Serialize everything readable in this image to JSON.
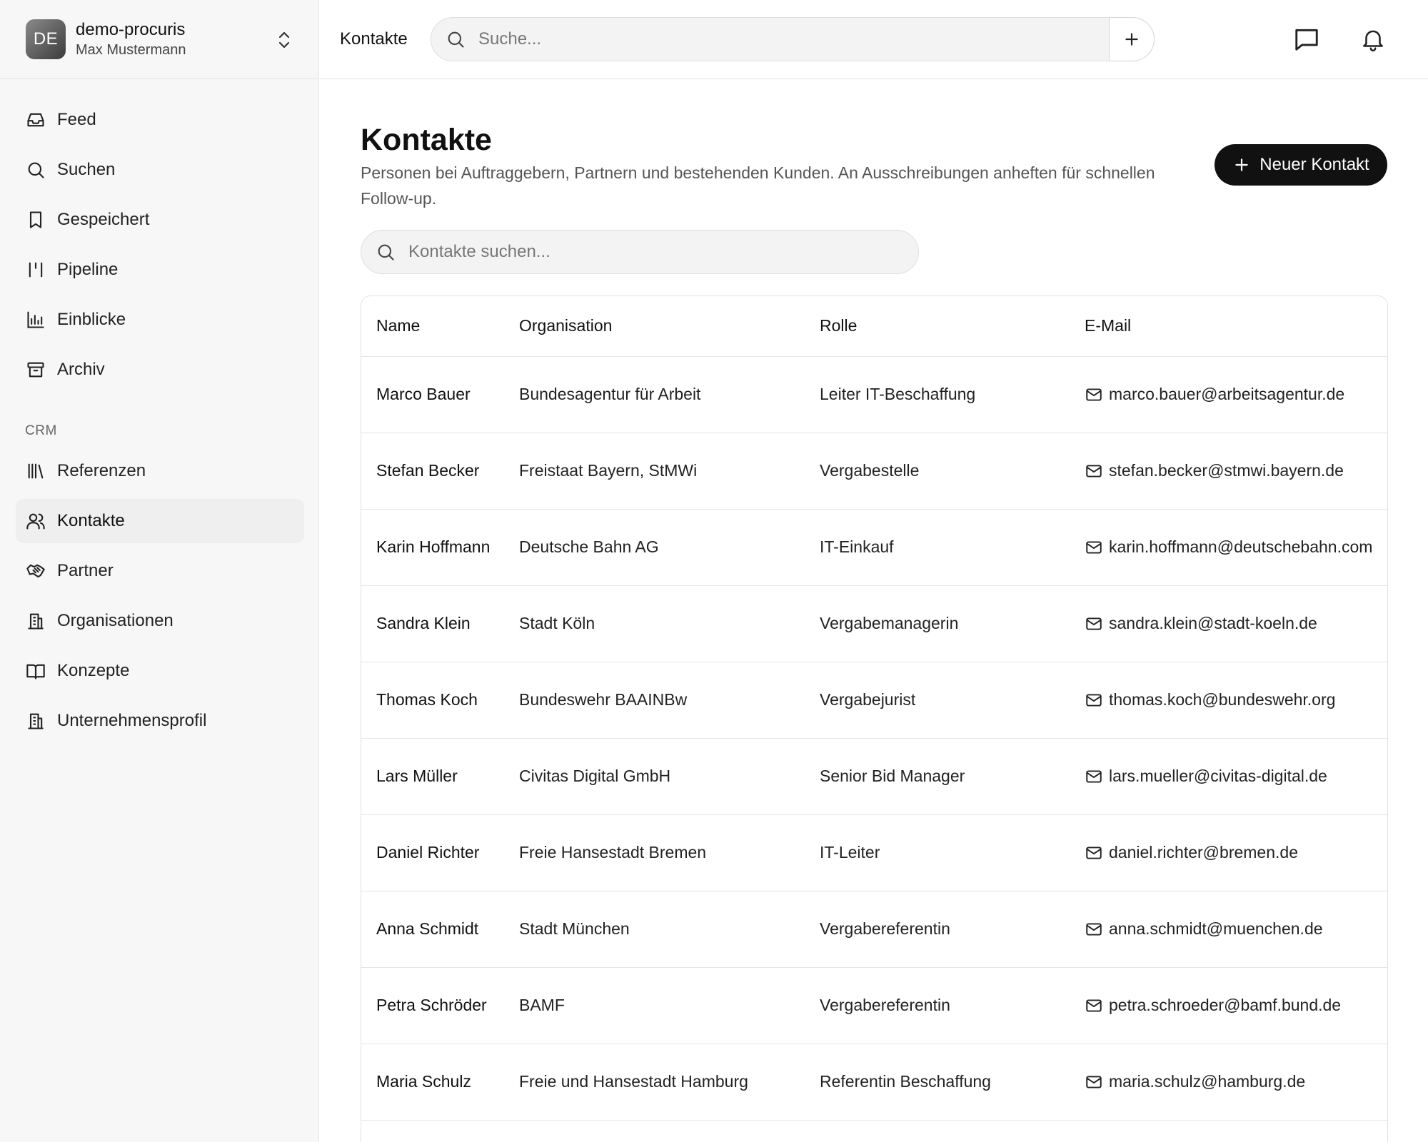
{
  "workspace": {
    "initials": "DE",
    "name": "demo-procuris",
    "user": "Max Mustermann"
  },
  "sidebar": {
    "items": [
      {
        "label": "Feed",
        "icon": "inbox-icon"
      },
      {
        "label": "Suchen",
        "icon": "search-icon"
      },
      {
        "label": "Gespeichert",
        "icon": "bookmark-icon"
      },
      {
        "label": "Pipeline",
        "icon": "pipeline-icon"
      },
      {
        "label": "Einblicke",
        "icon": "bar-chart-icon"
      },
      {
        "label": "Archiv",
        "icon": "archive-icon"
      }
    ],
    "crm_title": "CRM",
    "crm_items": [
      {
        "label": "Referenzen",
        "icon": "library-icon"
      },
      {
        "label": "Kontakte",
        "icon": "users-icon",
        "active": true
      },
      {
        "label": "Partner",
        "icon": "handshake-icon"
      },
      {
        "label": "Organisationen",
        "icon": "building-icon"
      },
      {
        "label": "Konzepte",
        "icon": "book-open-icon"
      },
      {
        "label": "Unternehmensprofil",
        "icon": "building-icon"
      }
    ]
  },
  "topbar": {
    "title": "Kontakte",
    "search_placeholder": "Suche..."
  },
  "page": {
    "title": "Kontakte",
    "description": "Personen bei Auftraggebern, Partnern und bestehenden Kunden. An Ausschreibungen anheften für schnellen Follow-up.",
    "new_button": "Neuer Kontakt",
    "search_placeholder": "Kontakte suchen..."
  },
  "table": {
    "columns": [
      "Name",
      "Organisation",
      "Rolle",
      "E-Mail"
    ],
    "rows": [
      {
        "name": "Marco Bauer",
        "org": "Bundesagentur für Arbeit",
        "role": "Leiter IT-Beschaffung",
        "email": "marco.bauer@arbeitsagentur.de"
      },
      {
        "name": "Stefan Becker",
        "org": "Freistaat Bayern, StMWi",
        "role": "Vergabestelle",
        "email": "stefan.becker@stmwi.bayern.de"
      },
      {
        "name": "Karin Hoffmann",
        "org": "Deutsche Bahn AG",
        "role": "IT-Einkauf",
        "email": "karin.hoffmann@deutschebahn.com"
      },
      {
        "name": "Sandra Klein",
        "org": "Stadt Köln",
        "role": "Vergabemanagerin",
        "email": "sandra.klein@stadt-koeln.de"
      },
      {
        "name": "Thomas Koch",
        "org": "Bundeswehr BAAINBw",
        "role": "Vergabejurist",
        "email": "thomas.koch@bundeswehr.org"
      },
      {
        "name": "Lars Müller",
        "org": "Civitas Digital GmbH",
        "role": "Senior Bid Manager",
        "email": "lars.mueller@civitas-digital.de"
      },
      {
        "name": "Daniel Richter",
        "org": "Freie Hansestadt Bremen",
        "role": "IT-Leiter",
        "email": "daniel.richter@bremen.de"
      },
      {
        "name": "Anna Schmidt",
        "org": "Stadt München",
        "role": "Vergabereferentin",
        "email": "anna.schmidt@muenchen.de"
      },
      {
        "name": "Petra Schröder",
        "org": "BAMF",
        "role": "Vergabereferentin",
        "email": "petra.schroeder@bamf.bund.de"
      },
      {
        "name": "Maria Schulz",
        "org": "Freie und Hansestadt Hamburg",
        "role": "Referentin Beschaffung",
        "email": "maria.schulz@hamburg.de"
      },
      {
        "name": "",
        "org": "",
        "role": "",
        "email": ""
      }
    ]
  }
}
